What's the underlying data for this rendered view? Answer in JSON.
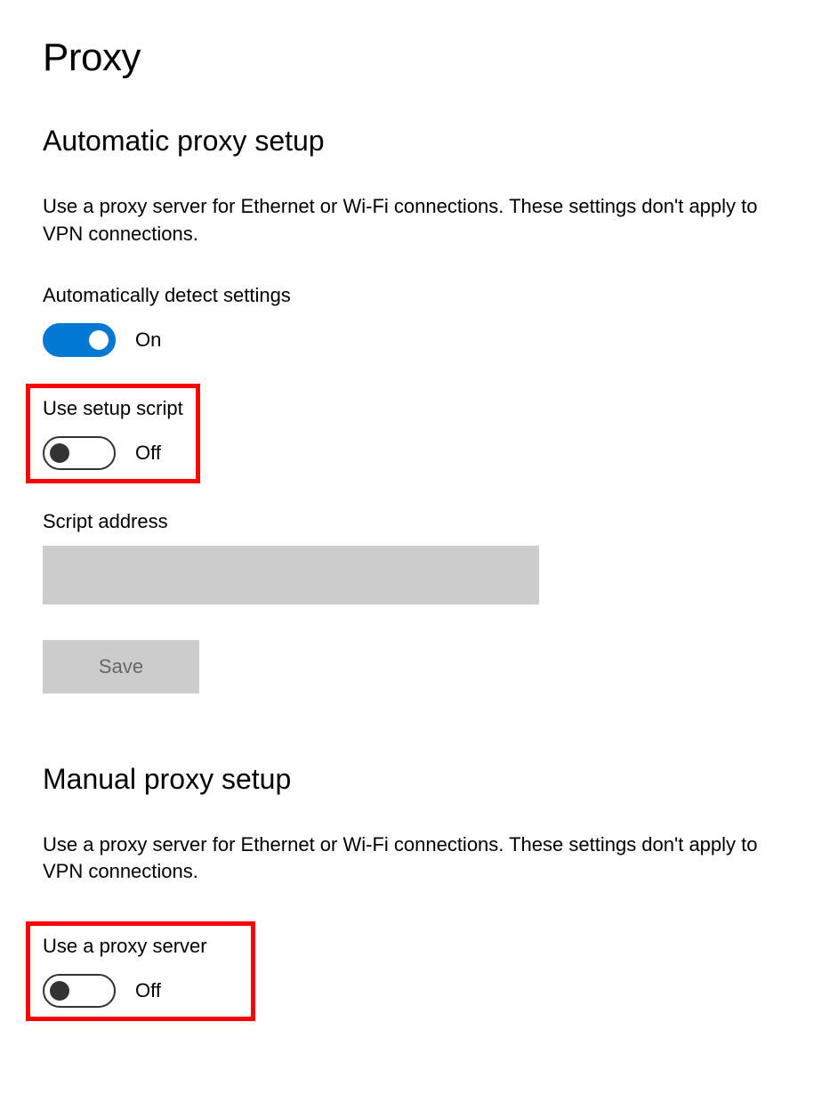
{
  "page": {
    "title": "Proxy"
  },
  "automatic": {
    "heading": "Automatic proxy setup",
    "description": "Use a proxy server for Ethernet or Wi-Fi connections. These settings don't apply to VPN connections.",
    "detect": {
      "label": "Automatically detect settings",
      "state": "On"
    },
    "setup_script": {
      "label": "Use setup script",
      "state": "Off"
    },
    "script_address": {
      "label": "Script address",
      "value": ""
    },
    "save_label": "Save"
  },
  "manual": {
    "heading": "Manual proxy setup",
    "description": "Use a proxy server for Ethernet or Wi-Fi connections. These settings don't apply to VPN connections.",
    "use_proxy": {
      "label": "Use a proxy server",
      "state": "Off"
    }
  }
}
